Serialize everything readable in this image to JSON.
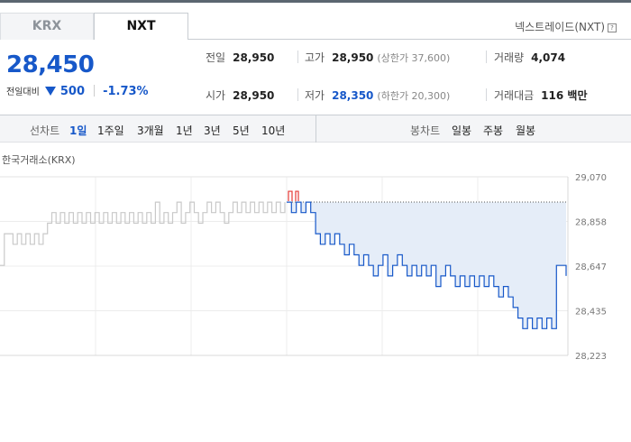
{
  "tabs": [
    {
      "label": "KRX",
      "active": false
    },
    {
      "label": "NXT",
      "active": true
    }
  ],
  "nxt_link": "넥스트레이드(NXT)",
  "help_icon": "?",
  "quote": {
    "price": "28,450",
    "change_label": "전일대비",
    "change": "500",
    "change_pct": "-1.73%",
    "direction": "down"
  },
  "stats": {
    "prev_close": {
      "label": "전일",
      "value": "28,950"
    },
    "open": {
      "label": "시가",
      "value": "28,950"
    },
    "high": {
      "label": "고가",
      "value": "28,950",
      "sub": "(상한가 37,600)"
    },
    "low": {
      "label": "저가",
      "value": "28,350",
      "sub": "(하한가 20,300)"
    },
    "volume": {
      "label": "거래량",
      "value": "4,074"
    },
    "amount": {
      "label": "거래대금",
      "value": "116 백만"
    }
  },
  "controls": {
    "line_label": "선차트",
    "periods": [
      "1일",
      "1주일",
      "3개월",
      "1년",
      "3년",
      "5년",
      "10년"
    ],
    "active_period": "1일",
    "candle_label": "봉차트",
    "candle_periods": [
      "일봉",
      "주봉",
      "월봉"
    ]
  },
  "chart_source": "한국거래소(KRX)",
  "colors": {
    "accent": "#1758c9",
    "up": "#e53935",
    "krx_line": "#c9c9c9",
    "fill": "#e5edf8"
  },
  "chart_data": {
    "type": "line",
    "ylim": [
      28223,
      29070
    ],
    "yticks": [
      "29,070",
      "28,858",
      "28,647",
      "28,435",
      "28,223"
    ],
    "reference": 28950,
    "grid": true,
    "series": [
      {
        "values": [
          28650,
          28800,
          28800,
          28750,
          28800,
          28750,
          28800,
          28750,
          28800,
          28750,
          28800,
          28850,
          28900,
          28850,
          28900,
          28850,
          28900,
          28850,
          28900,
          28850,
          28900,
          28850,
          28900,
          28850,
          28900,
          28850,
          28900,
          28850,
          28900,
          28850,
          28900,
          28850,
          28900,
          28850,
          28900,
          28850,
          28950,
          28850,
          28900,
          28850,
          28900,
          28950,
          28850,
          28900,
          28950,
          28900,
          28850,
          28900,
          28950,
          28900,
          28950,
          28900,
          28850,
          28900,
          28950,
          28900,
          28950,
          28900,
          28950,
          28900,
          28950,
          28900,
          28950,
          28900,
          28950,
          28900,
          28950
        ]
      },
      {
        "values": [
          28950,
          28900,
          28950,
          28900,
          28950,
          28900,
          28800,
          28750,
          28800,
          28750,
          28800,
          28750,
          28700,
          28750,
          28700,
          28650,
          28700,
          28650,
          28600,
          28650,
          28700,
          28600,
          28650,
          28700,
          28650,
          28600,
          28650,
          28600,
          28650,
          28600,
          28650,
          28550,
          28600,
          28650,
          28600,
          28550,
          28600,
          28550,
          28600,
          28550,
          28600,
          28550,
          28600,
          28550,
          28500,
          28550,
          28500,
          28450,
          28400,
          28350,
          28400,
          28350,
          28400,
          28350,
          28400,
          28350,
          28650,
          28650,
          28600
        ]
      }
    ]
  }
}
